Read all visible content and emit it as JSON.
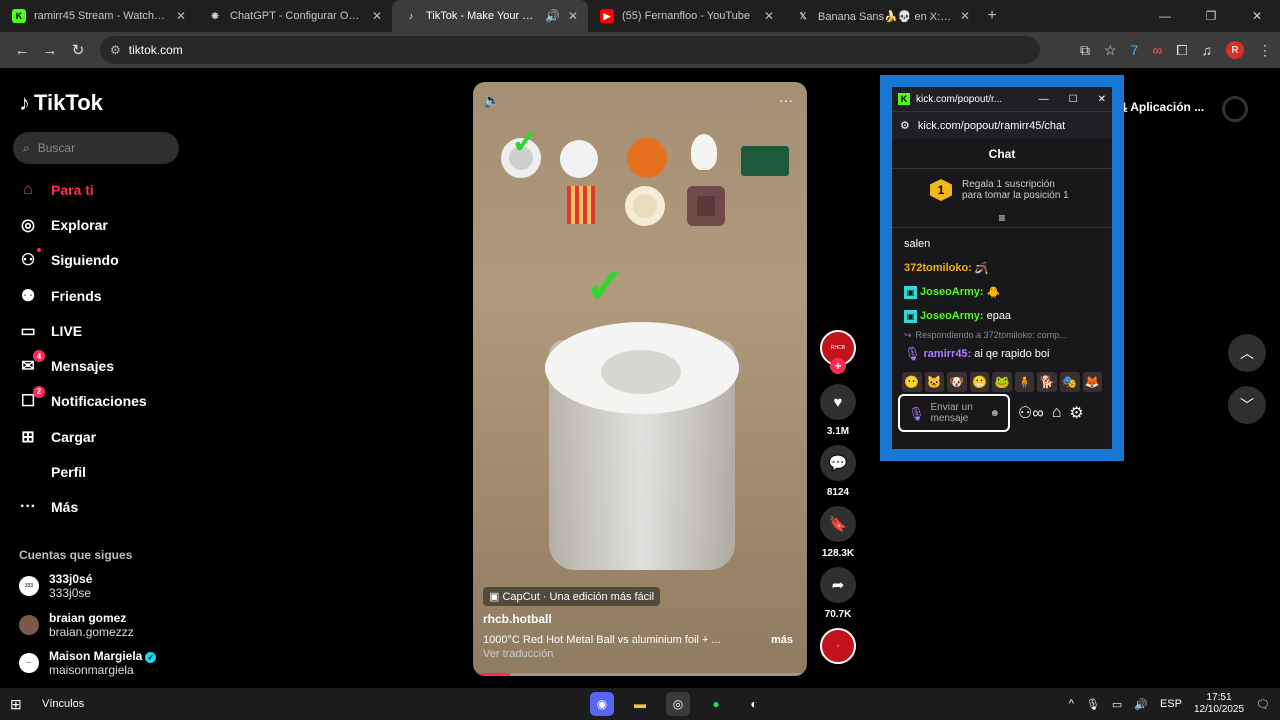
{
  "tabs": [
    {
      "title": "ramirr45 Stream - Watch Live o",
      "icon": "kick-icon",
      "active": false
    },
    {
      "title": "ChatGPT - Configurar OBS para",
      "icon": "chatgpt-icon",
      "active": false
    },
    {
      "title": "TikTok - Make Your Day",
      "icon": "tiktok-icon",
      "active": true
    },
    {
      "title": "(55) Fernanfloo - YouTube",
      "icon": "youtube-icon",
      "active": false
    },
    {
      "title": "Banana Sans🍌💀 en X: \"https:",
      "icon": "x-icon",
      "active": false
    }
  ],
  "address": {
    "url": "tiktok.com"
  },
  "tiktok": {
    "logo": "TikTok",
    "search_placeholder": "Buscar",
    "menu": [
      {
        "label": "Para ti",
        "icon": "home-icon",
        "active": true
      },
      {
        "label": "Explorar",
        "icon": "compass-icon"
      },
      {
        "label": "Siguiendo",
        "icon": "following-icon"
      },
      {
        "label": "Friends",
        "icon": "friends-icon"
      },
      {
        "label": "LIVE",
        "icon": "live-icon"
      },
      {
        "label": "Mensajes",
        "icon": "messages-icon",
        "badge": "4"
      },
      {
        "label": "Notificaciones",
        "icon": "notifications-icon",
        "badge": "2"
      },
      {
        "label": "Cargar",
        "icon": "upload-icon"
      },
      {
        "label": "Perfil",
        "icon": "profile-icon"
      },
      {
        "label": "Más",
        "icon": "more-icon"
      }
    ],
    "following_header": "Cuentas que sigues",
    "following": [
      {
        "name": "333j0sé",
        "handle": "333j0se"
      },
      {
        "name": "braian gomez",
        "handle": "braian.gomezzz"
      },
      {
        "name": "Maison Margiela",
        "handle": "maisonmargiela",
        "verified": true
      }
    ],
    "upload_label": "Aplicación ..."
  },
  "video": {
    "capcut": "CapCut · Una edición más fácil",
    "user": "rhcb.hotball",
    "description": "1000°C Red Hot Metal Ball vs aluminium foil + ...",
    "more": "más",
    "translate": "Ver traducción",
    "progress_percent": 11
  },
  "actions": {
    "likes": "3.1M",
    "comments": "8124",
    "saves": "128.3K",
    "shares": "70.7K"
  },
  "kick_popup": {
    "window_title": "kick.com/popout/r...",
    "url": "kick.com/popout/ramirr45/chat",
    "chat_title": "Chat",
    "gift_rank": "1",
    "gift_line1": "Regala 1 suscripción",
    "gift_line2": "para tomar la posición 1",
    "messages": [
      {
        "text": "salen"
      },
      {
        "user": "372tomiloko:",
        "emote": "🪃"
      },
      {
        "user": "JoseoArmy:",
        "emote": "🐥"
      },
      {
        "user": "JoseoArmy:",
        "text": " epaa"
      }
    ],
    "reply_to": "Respondiendo a 372tomiloko: comp...",
    "last_user": "ramirr45:",
    "last_text": " ai qe rapido boi",
    "send_placeholder": "Enviar un mensaje"
  },
  "taskbar": {
    "label": "Vínculos",
    "lang": "ESP",
    "time": "17:51",
    "date": "12/10/2025"
  }
}
